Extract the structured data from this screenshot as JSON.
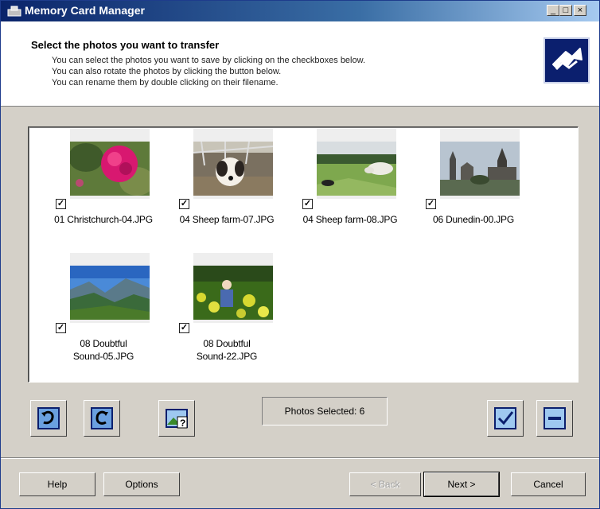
{
  "window": {
    "title": "Memory Card Manager"
  },
  "header": {
    "title": "Select the photos you want to transfer",
    "lines": [
      "You can select the photos you want to save by clicking on the checkboxes below.",
      "You can also rotate the photos by clicking the button below.",
      "You can rename them by double clicking on their filename."
    ]
  },
  "photos": [
    {
      "line1": "01 Christchurch-04.JPG",
      "line2": "",
      "checked": true
    },
    {
      "line1": "04 Sheep farm-07.JPG",
      "line2": "",
      "checked": true
    },
    {
      "line1": "04 Sheep farm-08.JPG",
      "line2": "",
      "checked": true
    },
    {
      "line1": "06 Dunedin-00.JPG",
      "line2": "",
      "checked": true
    },
    {
      "line1": "08 Doubtful",
      "line2": "Sound-05.JPG",
      "checked": true
    },
    {
      "line1": "08 Doubtful",
      "line2": "Sound-22.JPG",
      "checked": true
    }
  ],
  "status": {
    "photos_selected": "Photos Selected: 6"
  },
  "buttons": {
    "help": "Help",
    "options": "Options",
    "back": "< Back",
    "next": "Next >",
    "cancel": "Cancel"
  },
  "icons": {
    "rotate_left": "rotate-left-icon",
    "rotate_right": "rotate-right-icon",
    "preview": "image-preview-icon",
    "select_all": "select-all-icon",
    "deselect_all": "deselect-all-icon"
  }
}
